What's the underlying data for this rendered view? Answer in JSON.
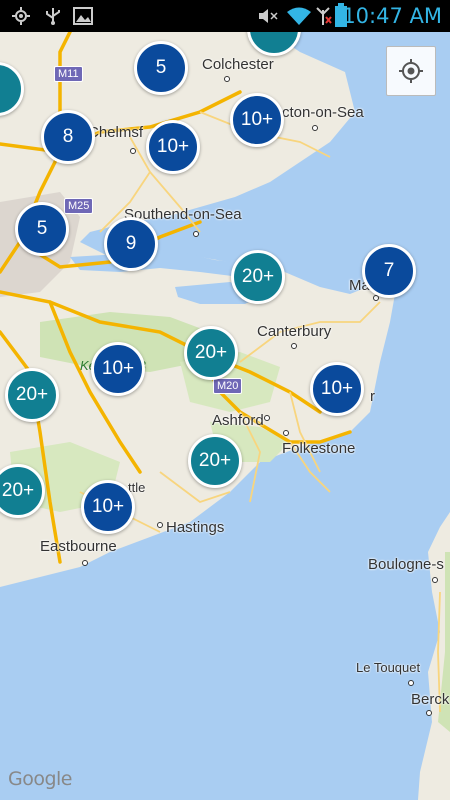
{
  "status_bar": {
    "time": "10:47 AM",
    "icons": [
      "location-icon",
      "usb-icon",
      "image-icon",
      "mute-icon",
      "wifi-icon",
      "signal-icon",
      "battery-icon"
    ]
  },
  "map": {
    "places": {
      "colchester": "Colchester",
      "chelmsford": "Chelmsf",
      "clacton": "cton-on-Sea",
      "southend": "Southend-on-Sea",
      "canterbury": "Canterbury",
      "ashford": "Ashford",
      "folkestone": "Folkestone",
      "hastings": "Hastings",
      "eastbourne": "Eastbourne",
      "boulogne": "Boulogne-s",
      "letouquet": "Le Touquet",
      "berck": "Berck",
      "margate": "Ma",
      "dover": "r",
      "battle": "ttle",
      "aonb": "Ke    s AONB"
    },
    "roads": {
      "m11": "M11",
      "m25": "M25",
      "m20": "M20"
    },
    "clusters": [
      {
        "label": "5",
        "color": "blue"
      },
      {
        "label": "10+",
        "color": "blue"
      },
      {
        "label": "8",
        "color": "blue"
      },
      {
        "label": "10+",
        "color": "blue"
      },
      {
        "label": "5",
        "color": "blue"
      },
      {
        "label": "9",
        "color": "blue"
      },
      {
        "label": "20+",
        "color": "teal"
      },
      {
        "label": "7",
        "color": "blue"
      },
      {
        "label": "20+",
        "color": "teal"
      },
      {
        "label": "10+",
        "color": "blue"
      },
      {
        "label": "20+",
        "color": "teal"
      },
      {
        "label": "10+",
        "color": "blue"
      },
      {
        "label": "20+",
        "color": "teal"
      },
      {
        "label": "20+",
        "color": "teal"
      },
      {
        "label": "10+",
        "color": "blue"
      }
    ],
    "attribution": "Google"
  },
  "colors": {
    "sea": "#a9cdf2",
    "land": "#eeebe1",
    "cluster_blue": "#0a4a9c",
    "cluster_teal": "#117f92",
    "status_time": "#33b5e5"
  }
}
